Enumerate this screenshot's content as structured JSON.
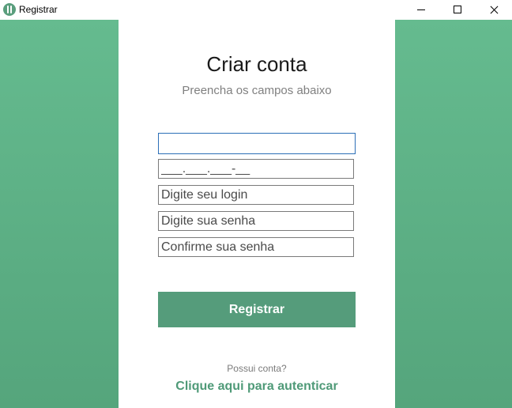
{
  "window": {
    "title": "Registrar",
    "icon": "app-icon"
  },
  "colors": {
    "accent": "#559c7b",
    "side_gradient_top": "#65bb8f",
    "side_gradient_bottom": "#55a57c"
  },
  "form": {
    "title": "Criar conta",
    "subtitle": "Preencha os campos abaixo",
    "fields": {
      "first": {
        "value": "",
        "placeholder": ""
      },
      "cpf": {
        "value": "___.___.___-__",
        "placeholder": ""
      },
      "login": {
        "value": "",
        "placeholder": "Digite seu login"
      },
      "password": {
        "value": "",
        "placeholder": "Digite sua senha"
      },
      "confirm": {
        "value": "",
        "placeholder": "Confirme sua senha"
      }
    },
    "submit_label": "Registrar",
    "has_account_text": "Possui conta?",
    "login_link": "Clique aqui para autenticar"
  }
}
